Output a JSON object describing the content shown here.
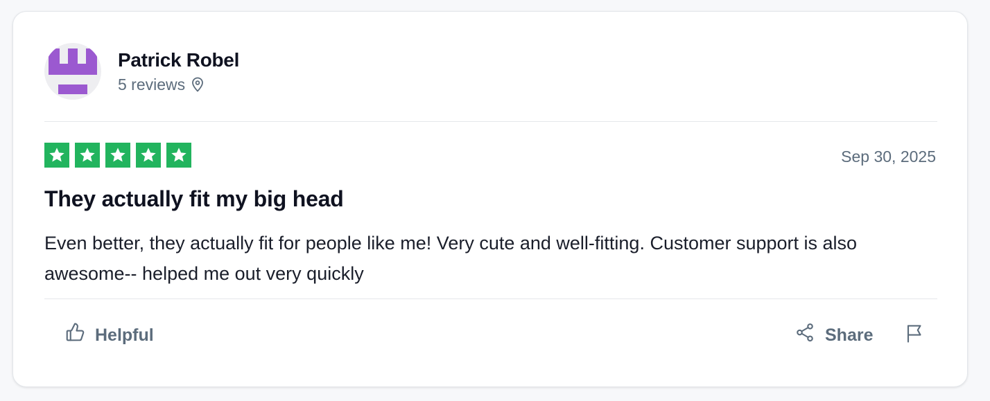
{
  "reviewer": {
    "name": "Patrick Robel",
    "reviews_count": "5 reviews",
    "avatar_color": "#9b59d0",
    "location_icon": "map-pin-icon"
  },
  "review": {
    "rating": 5,
    "rating_max": 5,
    "star_color": "#22b45e",
    "date": "Sep 30, 2025",
    "title": "They actually fit my big head",
    "body": "Even better, they actually fit for people like me! Very cute and well-fitting. Customer support is also awesome-- helped me out very quickly"
  },
  "actions": {
    "helpful_label": "Helpful",
    "helpful_icon": "thumbs-up-icon",
    "share_label": "Share",
    "share_icon": "share-icon",
    "flag_icon": "flag-icon"
  }
}
